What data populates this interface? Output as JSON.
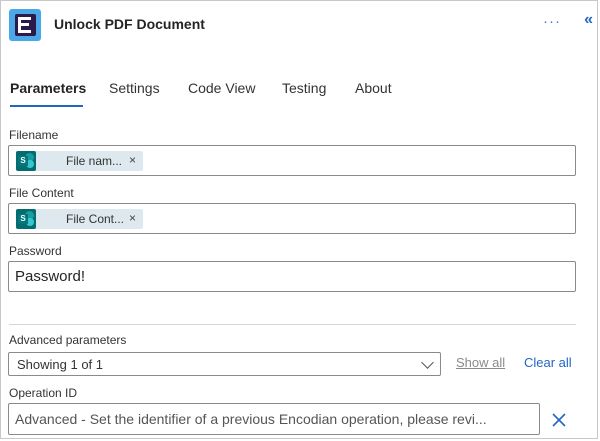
{
  "header": {
    "title": "Unlock PDF Document",
    "more_icon": "more-horizontal-icon",
    "collapse_icon": "double-chevron-left-icon"
  },
  "tabs": [
    {
      "label": "Parameters",
      "active": true
    },
    {
      "label": "Settings",
      "active": false
    },
    {
      "label": "Code View",
      "active": false
    },
    {
      "label": "Testing",
      "active": false
    },
    {
      "label": "About",
      "active": false
    }
  ],
  "fields": {
    "filename": {
      "label": "Filename",
      "token_text": "File nam...",
      "token_icon": "sharepoint-icon"
    },
    "file_content": {
      "label": "File Content",
      "token_text": "File Cont...",
      "token_icon": "sharepoint-icon"
    },
    "password": {
      "label": "Password",
      "value": "Password!"
    }
  },
  "advanced": {
    "label": "Advanced parameters",
    "select_value": "Showing 1 of 1",
    "show_all": "Show all",
    "clear_all": "Clear all"
  },
  "operation_id": {
    "label": "Operation ID",
    "placeholder": "Advanced - Set the identifier of a previous Encodian operation, please revi..."
  },
  "colors": {
    "accent": "#2266c4",
    "token_bg": "#dde8ef",
    "sharepoint": "#036c70"
  }
}
